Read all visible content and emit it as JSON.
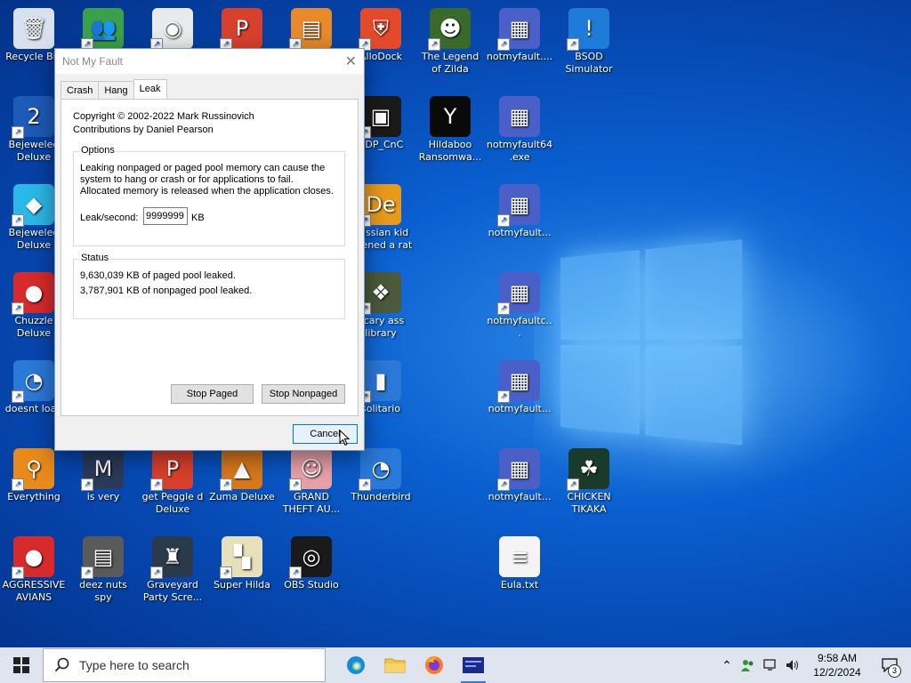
{
  "desktop": {
    "icons": [
      {
        "label": "Recycle Bin",
        "glyph": "🗑",
        "bg": "#d8e2ee",
        "shortcut": false
      },
      {
        "label": "",
        "glyph": "👥",
        "bg": "#3aa14a",
        "shortcut": true
      },
      {
        "label": "",
        "glyph": "◉",
        "bg": "#e8eaec",
        "shortcut": true
      },
      {
        "label": "",
        "glyph": "P",
        "bg": "#d9402b",
        "shortcut": true
      },
      {
        "label": "",
        "glyph": "▤",
        "bg": "#e88a2a",
        "shortcut": true
      },
      {
        "label": "AlloDock",
        "glyph": "⛨",
        "bg": "#e34a2a",
        "shortcut": true
      },
      {
        "label": "The Legend of Zilda",
        "glyph": "☻",
        "bg": "#3a6a2a",
        "shortcut": true
      },
      {
        "label": "notmyfault....",
        "glyph": "▦",
        "bg": "#4a60c8",
        "shortcut": true
      },
      {
        "label": "BSOD Simulator",
        "glyph": "!",
        "bg": "#1e7bd8",
        "shortcut": true
      },
      {
        "label": "Bejeweled Deluxe",
        "glyph": "2",
        "bg": "#1e5ab8",
        "shortcut": true
      },
      {
        "label": "RDP_CnC",
        "glyph": "▣",
        "bg": "#1a1a1a",
        "shortcut": true
      },
      {
        "label": "Hildaboo Ransomwa...",
        "glyph": "Y",
        "bg": "#0a0a0a",
        "shortcut": false
      },
      {
        "label": "notmyfault64.exe",
        "glyph": "▦",
        "bg": "#4a60c8",
        "shortcut": false
      },
      {
        "label": "Bejeweled Deluxe",
        "glyph": "◆",
        "bg": "#2ab8e8",
        "shortcut": true
      },
      {
        "label": "Russian kid opened a rat",
        "glyph": "De",
        "bg": "#e89a1a",
        "shortcut": true
      },
      {
        "label": "notmyfault...",
        "glyph": "▦",
        "bg": "#4a60c8",
        "shortcut": true
      },
      {
        "label": "Chuzzle Deluxe",
        "glyph": "●",
        "bg": "#d82a2a",
        "shortcut": true
      },
      {
        "label": "Scary ass library",
        "glyph": "❖",
        "bg": "#4a5a3a",
        "shortcut": true
      },
      {
        "label": "notmyfaultc...",
        "glyph": "▦",
        "bg": "#4a60c8",
        "shortcut": true
      },
      {
        "label": "doesnt load",
        "glyph": "◔",
        "bg": "#2a78d8",
        "shortcut": true
      },
      {
        "label": "solitario",
        "glyph": "▮",
        "bg": "#2a78d8",
        "shortcut": true
      },
      {
        "label": "notmyfault...",
        "glyph": "▦",
        "bg": "#4a60c8",
        "shortcut": true
      },
      {
        "label": "Everything",
        "glyph": "⚲",
        "bg": "#e88a1a",
        "shortcut": true
      },
      {
        "label": "is very",
        "glyph": "M",
        "bg": "#2a3a5a",
        "shortcut": true
      },
      {
        "label": "get Peggle d Deluxe",
        "glyph": "P",
        "bg": "#d9402b",
        "shortcut": true
      },
      {
        "label": "Zuma Deluxe",
        "glyph": "▲",
        "bg": "#d8781a",
        "shortcut": true
      },
      {
        "label": "GRAND THEFT AU...",
        "glyph": "☺",
        "bg": "#e8a0a8",
        "shortcut": true
      },
      {
        "label": "Thunderbird",
        "glyph": "◔",
        "bg": "#2a78d8",
        "shortcut": true
      },
      {
        "label": "notmyfault...",
        "glyph": "▦",
        "bg": "#4a60c8",
        "shortcut": true
      },
      {
        "label": "CHICKEN TIKAKA",
        "glyph": "☘",
        "bg": "#1a3a2a",
        "shortcut": true
      },
      {
        "label": "AGGRESSIVE AVIANS",
        "glyph": "●",
        "bg": "#d82a2a",
        "shortcut": true
      },
      {
        "label": "deez nuts spy",
        "glyph": "▤",
        "bg": "#5a5a5a",
        "shortcut": true
      },
      {
        "label": "Graveyard Party Scre...",
        "glyph": "♜",
        "bg": "#2a3a4a",
        "shortcut": true
      },
      {
        "label": "Super Hilda",
        "glyph": "▚",
        "bg": "#e8e0b8",
        "shortcut": true
      },
      {
        "label": "OBS Studio",
        "glyph": "◎",
        "bg": "#1a1a1a",
        "shortcut": true
      },
      {
        "label": "Eula.txt",
        "glyph": "≡",
        "bg": "#f4f4f4",
        "shortcut": false
      }
    ]
  },
  "dialog": {
    "title": "Not My Fault",
    "close_glyph": "✕",
    "tabs": [
      "Crash",
      "Hang",
      "Leak"
    ],
    "copyright": "Copyright © 2002-2022 Mark Russinovich",
    "contributions": "Contributions by Daniel Pearson",
    "options_title": "Options",
    "options_text": "Leaking nonpaged or paged pool memory can cause the system to hang or crash or for applications to fail. Allocated memory is released when the application closes.",
    "leak_label": "Leak/second:",
    "leak_value": "9999999",
    "leak_unit": "KB",
    "status_title": "Status",
    "status_line1": "9,630,039 KB of paged pool leaked.",
    "status_line2": "3,787,901 KB of nonpaged pool leaked.",
    "stop_paged": "Stop Paged",
    "stop_nonpaged": "Stop Nonpaged",
    "cancel": "Cancel"
  },
  "taskbar": {
    "search_placeholder": "Type here to search",
    "time": "9:58 AM",
    "date": "12/2/2024",
    "notification_count": "3"
  }
}
